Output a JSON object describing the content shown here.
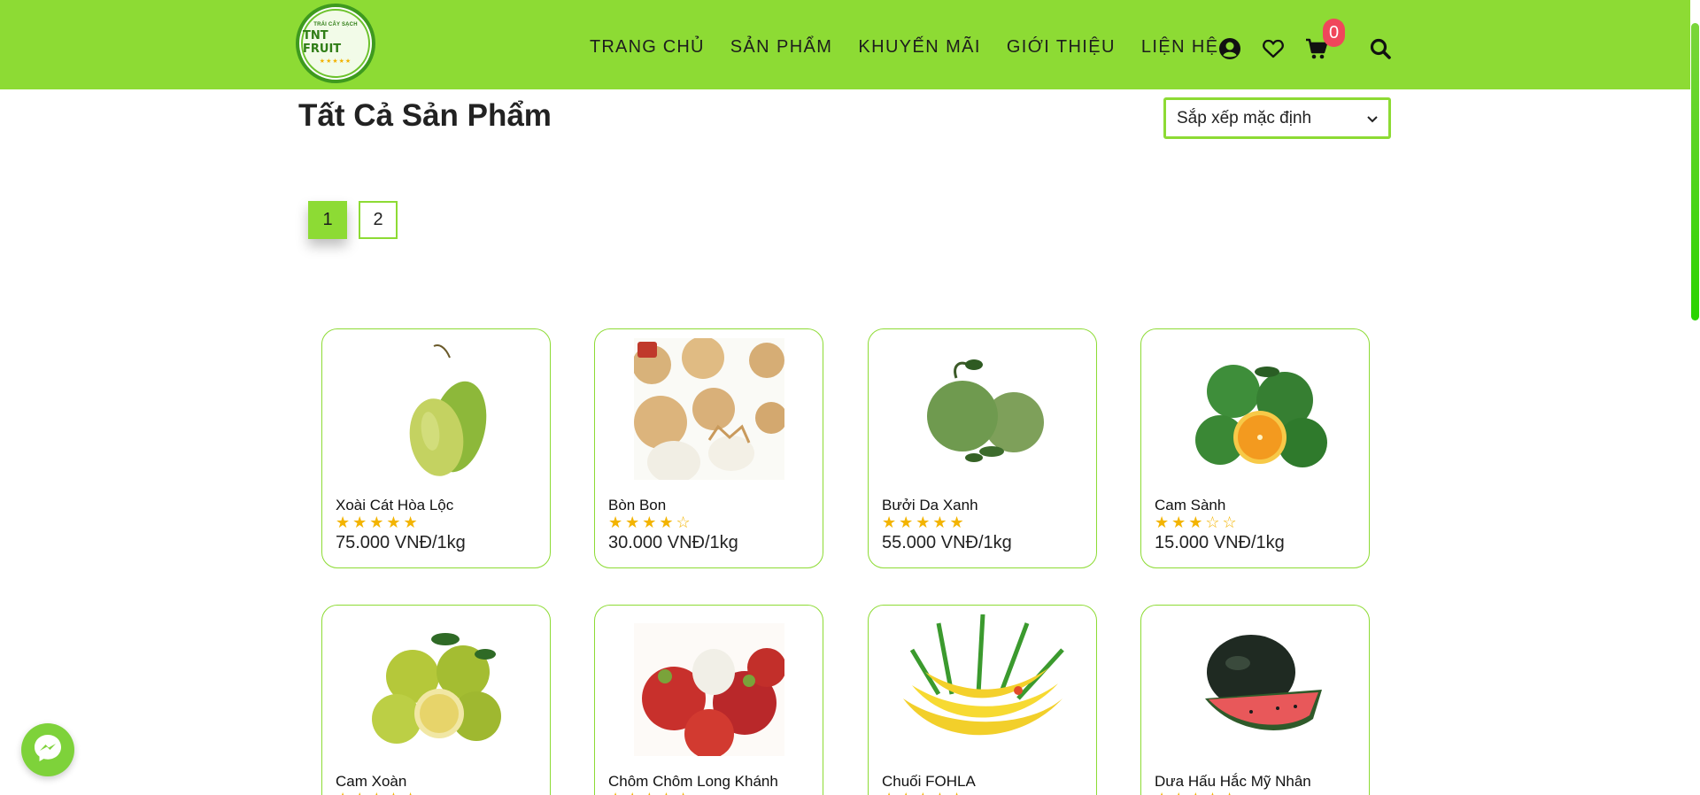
{
  "brand": {
    "logo_top_text": "TRÁI CÂY SẠCH",
    "logo_name": "TNT FRUIT",
    "logo_stars": "★★★★★"
  },
  "nav": {
    "items": [
      {
        "label": "TRANG CHỦ"
      },
      {
        "label": "SẢN PHẨM"
      },
      {
        "label": "KHUYẾN MÃI"
      },
      {
        "label": "GIỚI THIỆU"
      },
      {
        "label": "LIỆN HỆ"
      }
    ]
  },
  "header_icons": {
    "account": "user-circle-icon",
    "wishlist": "heart-icon",
    "cart": "cart-icon",
    "search": "search-icon",
    "cart_count": "0"
  },
  "page": {
    "title": "Tất Cả Sản Phẩm",
    "sort_selected": "Sắp xếp mặc định"
  },
  "pagination": {
    "pages": [
      "1",
      "2"
    ],
    "current": "1"
  },
  "products": [
    {
      "name": "Xoài Cát Hòa Lộc",
      "rating": 5,
      "stars": "★★★★★",
      "price": "75.000 VNĐ/1kg"
    },
    {
      "name": "Bòn Bon",
      "rating": 4,
      "stars": "★★★★☆",
      "price": "30.000 VNĐ/1kg"
    },
    {
      "name": "Bưởi Da Xanh",
      "rating": 5,
      "stars": "★★★★★",
      "price": "55.000 VNĐ/1kg"
    },
    {
      "name": "Cam Sành",
      "rating": 3,
      "stars": "★★★☆☆",
      "price": "15.000 VNĐ/1kg"
    },
    {
      "name": "Cam Xoàn",
      "rating": 5,
      "stars": "★★★★★",
      "price": ""
    },
    {
      "name": "Chôm Chôm Long Khánh",
      "rating": 5,
      "stars": "★★★★★",
      "price": ""
    },
    {
      "name": "Chuối FOHLA",
      "rating": 5,
      "stars": "★★★★★",
      "price": ""
    },
    {
      "name": "Dưa Hấu Hắc Mỹ Nhân",
      "rating": 5,
      "stars": "★★★★★",
      "price": ""
    }
  ],
  "colors": {
    "header_bg": "#8ddb34",
    "accent": "#8ddb34",
    "badge": "#f0475b",
    "star": "#f3b400"
  },
  "floating": {
    "messenger": "messenger-icon"
  }
}
